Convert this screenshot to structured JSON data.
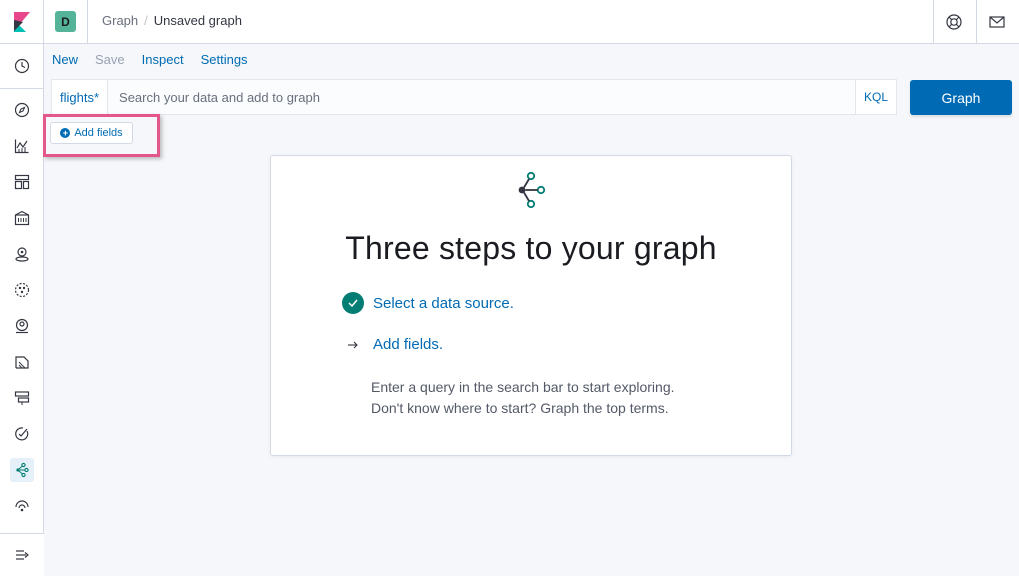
{
  "header": {
    "space_initial": "D",
    "breadcrumbs": [
      "Graph",
      "Unsaved graph"
    ],
    "separator": "/"
  },
  "sidebar": {
    "items": [
      {
        "name": "recently-viewed-icon"
      },
      {
        "name": "discover-icon"
      },
      {
        "name": "visualize-icon"
      },
      {
        "name": "dashboard-icon"
      },
      {
        "name": "canvas-icon"
      },
      {
        "name": "maps-icon"
      },
      {
        "name": "ml-icon"
      },
      {
        "name": "siem-icon"
      },
      {
        "name": "logs-icon"
      },
      {
        "name": "infrastructure-icon"
      },
      {
        "name": "uptime-icon"
      },
      {
        "name": "graph-icon",
        "active": true
      },
      {
        "name": "apm-icon"
      }
    ]
  },
  "topmenu": {
    "new_label": "New",
    "save_label": "Save",
    "inspect_label": "Inspect",
    "settings_label": "Settings"
  },
  "search": {
    "index_pattern": "flights*",
    "placeholder": "Search your data and add to graph",
    "value": "",
    "language": "KQL",
    "submit_label": "Graph"
  },
  "add_fields": {
    "label": "Add fields"
  },
  "guidance": {
    "title": "Three steps to your graph",
    "step1": "Select a data source.",
    "step2": "Add fields.",
    "step3_line1": "Enter a query in the search bar to start exploring.",
    "step3_line2": "Don't know where to start? Graph the top terms."
  },
  "colors": {
    "accent": "#006bb4",
    "success": "#017d73",
    "highlight": "#e3578b",
    "space_avatar": "#54b399"
  }
}
